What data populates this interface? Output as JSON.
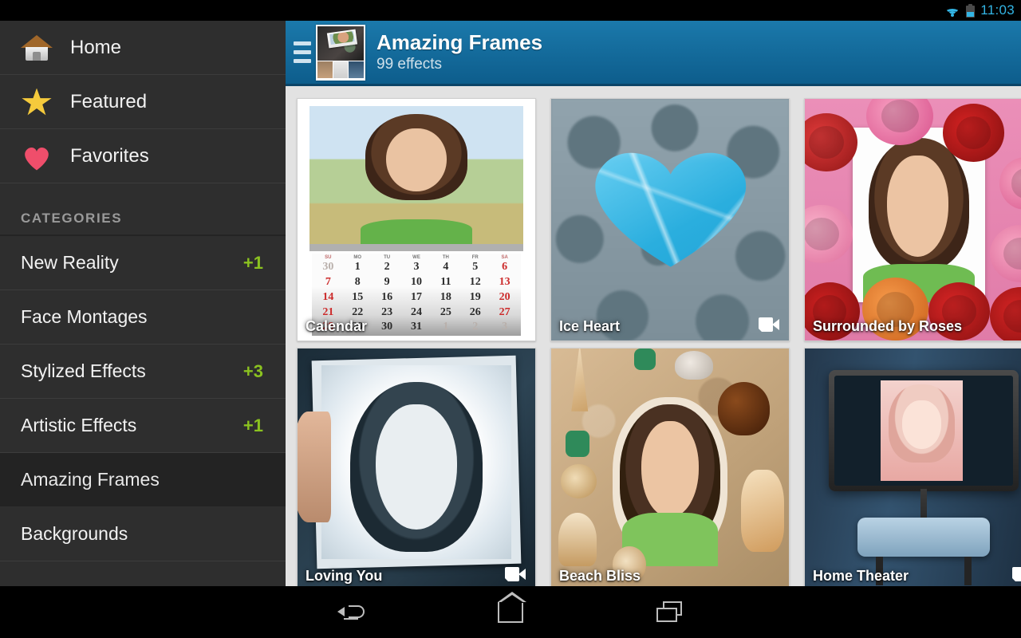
{
  "status_bar": {
    "time": "11:03",
    "wifi_icon": "wifi-icon",
    "battery_icon": "battery-icon",
    "accent_color": "#33b5e5"
  },
  "sidebar": {
    "nav_items": [
      {
        "label": "Home",
        "icon": "home-icon"
      },
      {
        "label": "Featured",
        "icon": "star-icon"
      },
      {
        "label": "Favorites",
        "icon": "heart-icon"
      }
    ],
    "section_header": "CATEGORIES",
    "categories": [
      {
        "label": "New Reality",
        "badge": "+1",
        "selected": false
      },
      {
        "label": "Face Montages",
        "badge": "",
        "selected": false
      },
      {
        "label": "Stylized Effects",
        "badge": "+3",
        "selected": false
      },
      {
        "label": "Artistic Effects",
        "badge": "+1",
        "selected": false
      },
      {
        "label": "Amazing Frames",
        "badge": "",
        "selected": true
      },
      {
        "label": "Backgrounds",
        "badge": "",
        "selected": false
      }
    ],
    "badge_color": "#8bc220",
    "background_color": "#2e2e2e",
    "selected_background_color": "#232323"
  },
  "appbar": {
    "menu_icon": "hamburger-menu-icon",
    "thumbnail": "app-collage-thumbnail",
    "title": "Amazing Frames",
    "subtitle": "99 effects",
    "background_color": "#1b79ab"
  },
  "grid": {
    "rows": [
      [
        {
          "title": "Calendar",
          "has_video": false
        },
        {
          "title": "Ice Heart",
          "has_video": true
        },
        {
          "title": "Surrounded by Roses",
          "has_video": false
        }
      ],
      [
        {
          "title": "Loving You",
          "has_video": true
        },
        {
          "title": "Beach Bliss",
          "has_video": false
        },
        {
          "title": "Home Theater",
          "has_video": true
        }
      ]
    ]
  },
  "calendar_tile": {
    "day_headers": [
      "SU",
      "MO",
      "TU",
      "WE",
      "TH",
      "FR",
      "SA"
    ],
    "weeks": [
      [
        "30",
        "1",
        "2",
        "3",
        "4",
        "5",
        "6"
      ],
      [
        "7",
        "8",
        "9",
        "10",
        "11",
        "12",
        "13"
      ],
      [
        "14",
        "15",
        "16",
        "17",
        "18",
        "19",
        "20"
      ],
      [
        "21",
        "22",
        "23",
        "24",
        "25",
        "26",
        "27"
      ],
      [
        "28",
        "29",
        "30",
        "31",
        "1",
        "2",
        "3"
      ]
    ]
  },
  "navbar": {
    "back": "back-button",
    "home": "home-button",
    "recents": "recent-apps-button"
  }
}
